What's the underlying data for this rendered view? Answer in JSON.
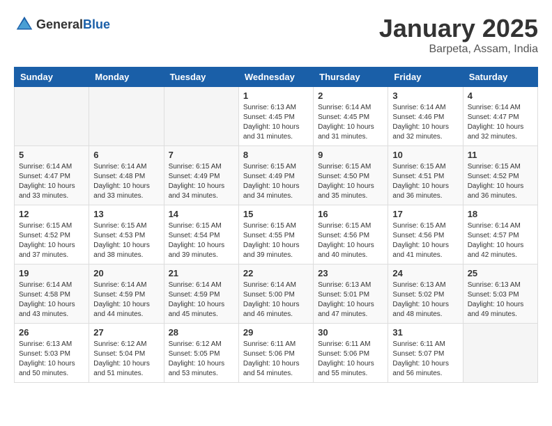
{
  "header": {
    "logo_general": "General",
    "logo_blue": "Blue",
    "month": "January 2025",
    "location": "Barpeta, Assam, India"
  },
  "weekdays": [
    "Sunday",
    "Monday",
    "Tuesday",
    "Wednesday",
    "Thursday",
    "Friday",
    "Saturday"
  ],
  "weeks": [
    [
      {
        "day": "",
        "info": ""
      },
      {
        "day": "",
        "info": ""
      },
      {
        "day": "",
        "info": ""
      },
      {
        "day": "1",
        "info": "Sunrise: 6:13 AM\nSunset: 4:45 PM\nDaylight: 10 hours\nand 31 minutes."
      },
      {
        "day": "2",
        "info": "Sunrise: 6:14 AM\nSunset: 4:45 PM\nDaylight: 10 hours\nand 31 minutes."
      },
      {
        "day": "3",
        "info": "Sunrise: 6:14 AM\nSunset: 4:46 PM\nDaylight: 10 hours\nand 32 minutes."
      },
      {
        "day": "4",
        "info": "Sunrise: 6:14 AM\nSunset: 4:47 PM\nDaylight: 10 hours\nand 32 minutes."
      }
    ],
    [
      {
        "day": "5",
        "info": "Sunrise: 6:14 AM\nSunset: 4:47 PM\nDaylight: 10 hours\nand 33 minutes."
      },
      {
        "day": "6",
        "info": "Sunrise: 6:14 AM\nSunset: 4:48 PM\nDaylight: 10 hours\nand 33 minutes."
      },
      {
        "day": "7",
        "info": "Sunrise: 6:15 AM\nSunset: 4:49 PM\nDaylight: 10 hours\nand 34 minutes."
      },
      {
        "day": "8",
        "info": "Sunrise: 6:15 AM\nSunset: 4:49 PM\nDaylight: 10 hours\nand 34 minutes."
      },
      {
        "day": "9",
        "info": "Sunrise: 6:15 AM\nSunset: 4:50 PM\nDaylight: 10 hours\nand 35 minutes."
      },
      {
        "day": "10",
        "info": "Sunrise: 6:15 AM\nSunset: 4:51 PM\nDaylight: 10 hours\nand 36 minutes."
      },
      {
        "day": "11",
        "info": "Sunrise: 6:15 AM\nSunset: 4:52 PM\nDaylight: 10 hours\nand 36 minutes."
      }
    ],
    [
      {
        "day": "12",
        "info": "Sunrise: 6:15 AM\nSunset: 4:52 PM\nDaylight: 10 hours\nand 37 minutes."
      },
      {
        "day": "13",
        "info": "Sunrise: 6:15 AM\nSunset: 4:53 PM\nDaylight: 10 hours\nand 38 minutes."
      },
      {
        "day": "14",
        "info": "Sunrise: 6:15 AM\nSunset: 4:54 PM\nDaylight: 10 hours\nand 39 minutes."
      },
      {
        "day": "15",
        "info": "Sunrise: 6:15 AM\nSunset: 4:55 PM\nDaylight: 10 hours\nand 39 minutes."
      },
      {
        "day": "16",
        "info": "Sunrise: 6:15 AM\nSunset: 4:56 PM\nDaylight: 10 hours\nand 40 minutes."
      },
      {
        "day": "17",
        "info": "Sunrise: 6:15 AM\nSunset: 4:56 PM\nDaylight: 10 hours\nand 41 minutes."
      },
      {
        "day": "18",
        "info": "Sunrise: 6:14 AM\nSunset: 4:57 PM\nDaylight: 10 hours\nand 42 minutes."
      }
    ],
    [
      {
        "day": "19",
        "info": "Sunrise: 6:14 AM\nSunset: 4:58 PM\nDaylight: 10 hours\nand 43 minutes."
      },
      {
        "day": "20",
        "info": "Sunrise: 6:14 AM\nSunset: 4:59 PM\nDaylight: 10 hours\nand 44 minutes."
      },
      {
        "day": "21",
        "info": "Sunrise: 6:14 AM\nSunset: 4:59 PM\nDaylight: 10 hours\nand 45 minutes."
      },
      {
        "day": "22",
        "info": "Sunrise: 6:14 AM\nSunset: 5:00 PM\nDaylight: 10 hours\nand 46 minutes."
      },
      {
        "day": "23",
        "info": "Sunrise: 6:13 AM\nSunset: 5:01 PM\nDaylight: 10 hours\nand 47 minutes."
      },
      {
        "day": "24",
        "info": "Sunrise: 6:13 AM\nSunset: 5:02 PM\nDaylight: 10 hours\nand 48 minutes."
      },
      {
        "day": "25",
        "info": "Sunrise: 6:13 AM\nSunset: 5:03 PM\nDaylight: 10 hours\nand 49 minutes."
      }
    ],
    [
      {
        "day": "26",
        "info": "Sunrise: 6:13 AM\nSunset: 5:03 PM\nDaylight: 10 hours\nand 50 minutes."
      },
      {
        "day": "27",
        "info": "Sunrise: 6:12 AM\nSunset: 5:04 PM\nDaylight: 10 hours\nand 51 minutes."
      },
      {
        "day": "28",
        "info": "Sunrise: 6:12 AM\nSunset: 5:05 PM\nDaylight: 10 hours\nand 53 minutes."
      },
      {
        "day": "29",
        "info": "Sunrise: 6:11 AM\nSunset: 5:06 PM\nDaylight: 10 hours\nand 54 minutes."
      },
      {
        "day": "30",
        "info": "Sunrise: 6:11 AM\nSunset: 5:06 PM\nDaylight: 10 hours\nand 55 minutes."
      },
      {
        "day": "31",
        "info": "Sunrise: 6:11 AM\nSunset: 5:07 PM\nDaylight: 10 hours\nand 56 minutes."
      },
      {
        "day": "",
        "info": ""
      }
    ]
  ]
}
